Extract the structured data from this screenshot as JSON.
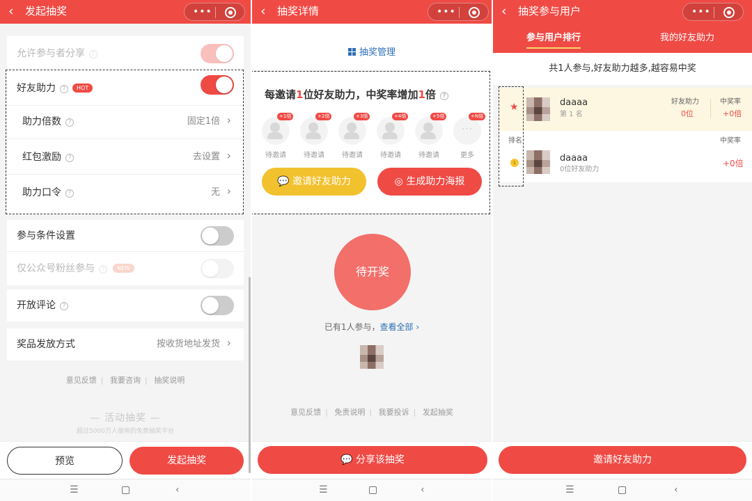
{
  "capsule_dots": "•••",
  "nav": {
    "menu": "☰",
    "back": "‹"
  },
  "panel1": {
    "title": "发起抽奖",
    "back_glyph": "‹",
    "rows": {
      "allow_share": "允许参与者分享",
      "friend_assist": "好友助力",
      "hot_badge": "HOT",
      "multiplier": "助力倍数",
      "multiplier_value": "固定1倍",
      "red_packet": "红包激励",
      "red_packet_value": "去设置",
      "password": "助力口令",
      "password_value": "无",
      "conditions": "参与条件设置",
      "fans_only": "仅公众号粉丝参与",
      "new_badge": "NEW",
      "comments": "开放评论",
      "delivery": "奖品发放方式",
      "delivery_value": "按收货地址发货"
    },
    "footer_links": [
      "意见反馈",
      "我要咨询",
      "抽奖说明"
    ],
    "brand": "— 活动抽奖 —",
    "brand_sub": "超过5000万人使用的免费抽奖平台",
    "preview_btn": "预览",
    "start_btn": "发起抽奖"
  },
  "panel2": {
    "title": "抽奖详情",
    "management": "抽奖管理",
    "invite_title": {
      "a": "每邀请",
      "n1": "1",
      "b": "位好友助力，中奖率增加",
      "n2": "1",
      "c": "倍"
    },
    "slots": [
      {
        "tag": "+1倍",
        "label": "待邀请"
      },
      {
        "tag": "+2倍",
        "label": "待邀请"
      },
      {
        "tag": "+3倍",
        "label": "待邀请"
      },
      {
        "tag": "+4倍",
        "label": "待邀请"
      },
      {
        "tag": "+5倍",
        "label": "待邀请"
      },
      {
        "tag": "+N倍",
        "label": "更多"
      }
    ],
    "more_glyph": "···",
    "invite_btn": "邀请好友助力",
    "poster_btn": "生成助力海报",
    "status": "待开奖",
    "joined": "已有1人参与，",
    "view_all": "查看全部 ›",
    "footer_links": [
      "意见反馈",
      "免责说明",
      "我要投诉",
      "发起抽奖"
    ],
    "share_btn": "分享该抽奖"
  },
  "panel3": {
    "title": "抽奖参与用户",
    "tab_rank": "参与用户排行",
    "tab_mine": "我的好友助力",
    "summary": "共1人参与,好友助力越多,越容易中奖",
    "rank_label": "排名",
    "col_assist": "好友助力",
    "col_rate": "中奖率",
    "row1": {
      "name": "daaaa",
      "sub": "第 1 名",
      "assist": "0位",
      "rate": "+0倍"
    },
    "row2": {
      "name": "daaaa",
      "sub": "0位好友助力",
      "rate": "+0倍",
      "coin": "1"
    },
    "star_glyph": "★",
    "invite_btn": "邀请好友助力"
  }
}
